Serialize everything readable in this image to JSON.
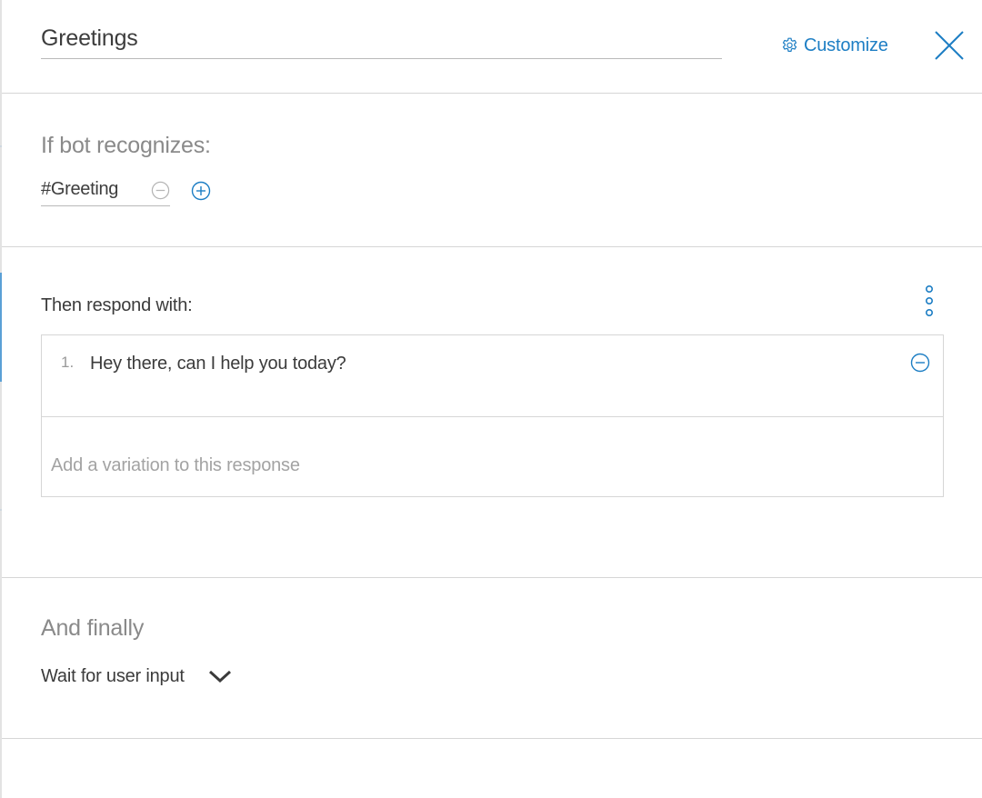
{
  "header": {
    "title": "Greetings",
    "customize_label": "Customize",
    "customize_icon": "gear-icon",
    "close_icon": "close-icon"
  },
  "condition": {
    "heading": "If bot recognizes:",
    "intent": "#Greeting",
    "remove_icon": "minus-circle-icon",
    "add_icon": "plus-circle-icon"
  },
  "respond": {
    "heading": "Then respond with:",
    "menu_icon": "vertical-ellipsis-icon",
    "responses": [
      {
        "number": "1.",
        "text": "Hey there, can I help you today?"
      }
    ],
    "variation_placeholder": "Add a variation to this response",
    "variation_value": ""
  },
  "finally": {
    "heading": "And finally",
    "selected": "Wait for user input",
    "dropdown_icon": "chevron-down-icon"
  },
  "colors": {
    "accent": "#1d7ec4",
    "muted_text": "#8a8a8a",
    "divider": "#d6d6d6"
  }
}
